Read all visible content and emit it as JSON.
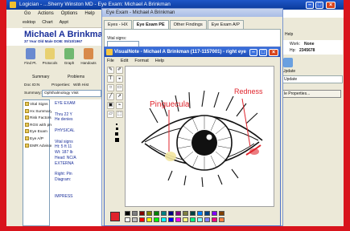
{
  "app": {
    "title": "Logician - ...Sherry Winston MD - Eye Exam: Michael A Brinkman",
    "menu": [
      "Go",
      "Actions",
      "Options",
      "Help"
    ],
    "toolbar": [
      "Desktop",
      "Chart",
      "Appt"
    ]
  },
  "patient": {
    "name": "Michael A Brinkman",
    "details": "37 Year Old Male  DOB: 05/10/1967"
  },
  "main_toolbar": [
    {
      "label": "Find Pt.",
      "icon": "find-patient-icon"
    },
    {
      "label": "Protocols",
      "icon": "protocols-icon"
    },
    {
      "label": "Graph",
      "icon": "graph-icon"
    },
    {
      "label": "Handouts",
      "icon": "handouts-icon"
    }
  ],
  "chart_tabs": [
    "Summary",
    "Problems"
  ],
  "fields": {
    "doc_id_label": "Doc ID:",
    "doc_id_value": "N",
    "properties_label": "Properties:",
    "properties_value": "With Hist",
    "summary_label": "Summary:",
    "summary_value": "Ophthalmology Visit"
  },
  "tree_items": [
    "Vital Signs",
    "Hx Summary",
    "Risk Factors-Previous",
    "ROS with prev",
    "Eye Exam",
    "Eye A/P",
    "EMR Advisor"
  ],
  "note_lines": [
    {
      "text": "EYE EXAM",
      "style": "blue"
    },
    {
      "text": "",
      "style": ""
    },
    {
      "text": "Thru 22 Y",
      "style": "blue"
    },
    {
      "text": "He denies",
      "style": "blue"
    },
    {
      "text": "",
      "style": ""
    },
    {
      "text": "PHYSICAL",
      "style": "blue"
    },
    {
      "text": "",
      "style": ""
    },
    {
      "text": "Vital signs",
      "style": "blue"
    },
    {
      "text": "Ht: 5 ft 11",
      "style": "blue"
    },
    {
      "text": "Wt: 187 lb",
      "style": "blue"
    },
    {
      "text": "Head: NC/A",
      "style": "blue"
    },
    {
      "text": "EXTERNA",
      "style": "blue"
    },
    {
      "text": "",
      "style": ""
    },
    {
      "text": "Right: Pin",
      "style": "blue"
    },
    {
      "text": "Diagram:",
      "style": "blue"
    },
    {
      "text": "",
      "style": ""
    },
    {
      "text": "",
      "style": ""
    },
    {
      "text": "IMPRESS",
      "style": "blue"
    }
  ],
  "right_panel": {
    "help": "Help",
    "work_label": "Work:",
    "work_value": "None",
    "hp_label": "Hp:",
    "hp_value": "2345678",
    "update": "Update",
    "update_tab": "Update",
    "properties_btn": "le Properties..."
  },
  "exam": {
    "title": "Eye Exam - Michael A Brinkman",
    "tabs": [
      "Eyes - HX",
      "Eye Exam PE",
      "Other Findings",
      "Eye Exam A/P"
    ],
    "active_tab": 1,
    "vital_label": "Vital signs:"
  },
  "visualnote": {
    "title": "VisualNote - Michael A Brinkman (117-1157001) - right eye",
    "menu": [
      "File",
      "Edit",
      "Format",
      "Help"
    ],
    "annotations": {
      "pinguecula": "Pinguecula",
      "redness": "Redness"
    }
  },
  "colors": {
    "selected": "#e0242c",
    "annotation": "#e0242c",
    "frame": "#d8141c",
    "titlebar": "#1d4cb5"
  },
  "palette": [
    "#000000",
    "#808080",
    "#800000",
    "#808000",
    "#008000",
    "#008080",
    "#000080",
    "#800080",
    "#808040",
    "#004040",
    "#0080ff",
    "#004080",
    "#8000ff",
    "#804000",
    "#ffffff",
    "#c0c0c0",
    "#ff0000",
    "#ffff00",
    "#00ff00",
    "#00ffff",
    "#0000ff",
    "#ff00ff",
    "#ffff80",
    "#00ff80",
    "#80ffff",
    "#8080ff",
    "#ff0080",
    "#ff8040"
  ]
}
